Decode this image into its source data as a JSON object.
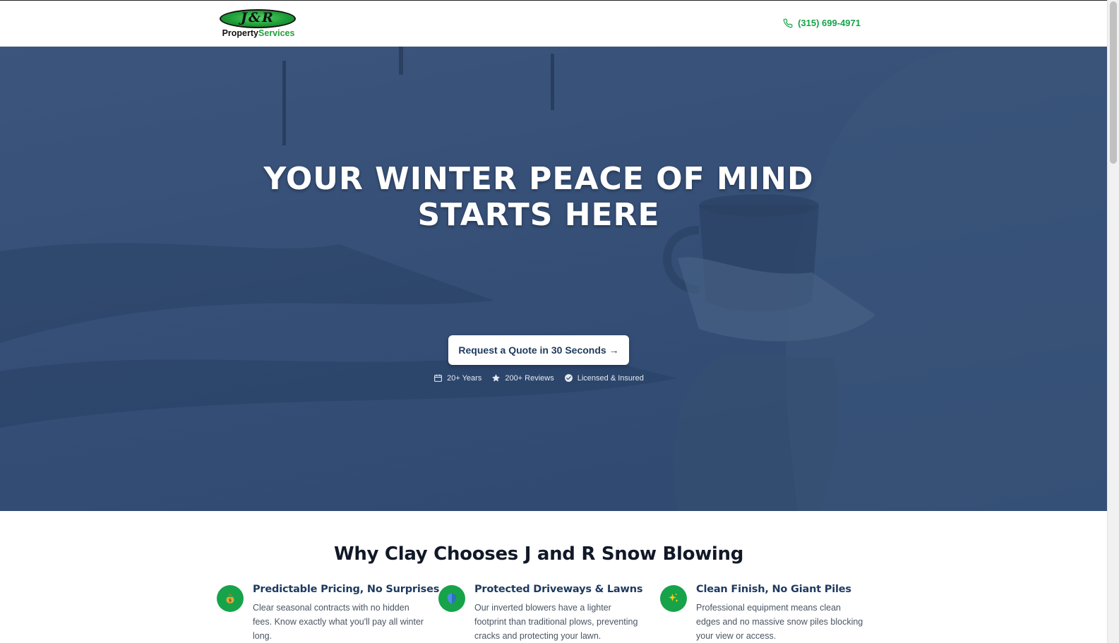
{
  "header": {
    "logo_monogram": "J&R",
    "logo_word1": "Property",
    "logo_word2": "Services",
    "phone": "(315) 699-4971"
  },
  "hero": {
    "title_line1": "YOUR WINTER PEACE OF MIND",
    "title_line2": "STARTS HERE",
    "cta_label": "Request a Quote in 30 Seconds →",
    "trust": [
      {
        "icon": "calendar-icon",
        "label": "20+ Years"
      },
      {
        "icon": "star-icon",
        "label": "200+ Reviews"
      },
      {
        "icon": "check-circle-icon",
        "label": "Licensed & Insured"
      }
    ]
  },
  "why": {
    "title": "Why Clay Chooses J and R Snow Blowing",
    "features": [
      {
        "icon": "money-bag-icon",
        "title": "Predictable Pricing, No Surprises",
        "desc": "Clear seasonal contracts with no hidden fees. Know exactly what you'll pay all winter long."
      },
      {
        "icon": "shield-icon",
        "title": "Protected Driveways & Lawns",
        "desc": "Our inverted blowers have a lighter footprint than traditional plows, preventing cracks and protecting your lawn."
      },
      {
        "icon": "sparkles-icon",
        "title": "Clean Finish, No Giant Piles",
        "desc": "Professional equipment means clean edges and no massive snow piles blocking your view or access."
      }
    ]
  },
  "colors": {
    "brand_green": "#16a34a",
    "navy": "#1e3a5f",
    "hero_overlay": "#28426c"
  }
}
